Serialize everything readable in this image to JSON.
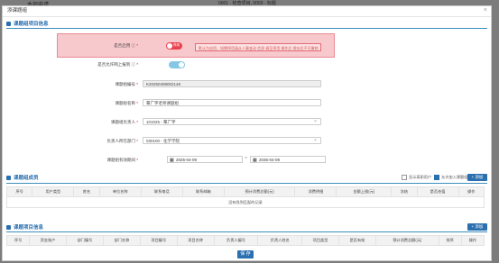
{
  "background": {
    "title": "本部申请",
    "right_text": "0001 · 检查项目, 0000 · 标题"
  },
  "modal": {
    "title": "添课题组"
  },
  "section1": {
    "title": "课题组项目信息"
  },
  "form": {
    "enable": {
      "label": "是否启用",
      "toggle_text": "停用",
      "tip": "默认为启用，如需停用请从人事变动 信息 调至停用 操作后 保存后不可撤销"
    },
    "allow_register": {
      "label": "是否允许网上报到"
    },
    "group_no": {
      "label": "课题组编号",
      "value": "K20250409002148"
    },
    "group_name": {
      "label": "课题组名称",
      "value": "覃广宇老师课题组"
    },
    "leader": {
      "label": "课题组负责人",
      "value": "101025 - 覃广宇"
    },
    "dept": {
      "label": "负责人所在部门",
      "value": "030100 - 化学学院"
    },
    "period": {
      "label": "课题组有效期间",
      "start": "2025-04-09",
      "sep": "~",
      "end": "2035-04-09"
    }
  },
  "section2": {
    "title": "课题组成员",
    "check1": "显示离职用户",
    "check2": "允许加入课题组",
    "add": "+ 添加",
    "columns": [
      "序号",
      "用户类型",
      "姓名",
      "单位名称",
      "联系电话",
      "联系邮箱",
      "预计消费总额(元)",
      "消费明细",
      "金额上限(元)",
      "冻结",
      "是否充值",
      "操作"
    ],
    "empty": "没有找到匹配的记录"
  },
  "section3": {
    "title": "课题项目信息",
    "add": "+ 添加",
    "columns": [
      "序号",
      "资金账户",
      "部门编号",
      "部门名称",
      "项目编号",
      "项目名称",
      "负责人编号",
      "负责人姓名",
      "项目类型",
      "是否有效",
      "预计消费总额(元)",
      "排序",
      "操作"
    ]
  },
  "buttons": {
    "save": "保 存"
  },
  "colors": {
    "accent": "#2a6fb0",
    "toggle_off": "#e8424f",
    "toggle_on": "#87c7e6",
    "highlight": "#f7c8cc"
  }
}
